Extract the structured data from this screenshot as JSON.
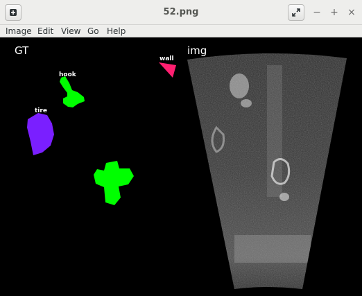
{
  "window": {
    "title": "52.png"
  },
  "menu": {
    "items": [
      "Image",
      "Edit",
      "View",
      "Go",
      "Help"
    ]
  },
  "panels": {
    "gt_label": "GT",
    "img_label": "img"
  },
  "annotations": {
    "wall": "wall",
    "hook": "hook",
    "tire": "tire"
  },
  "colors": {
    "wall": "#ff1f70",
    "hook": "#00ff00",
    "tire": "#7a1fff",
    "unlabeled_object": "#00ff00"
  },
  "icons": {
    "app": "app-menu-icon",
    "fullscreen": "fullscreen-icon",
    "minimize": "minimize-icon",
    "maximize": "maximize-icon",
    "close": "close-icon"
  }
}
